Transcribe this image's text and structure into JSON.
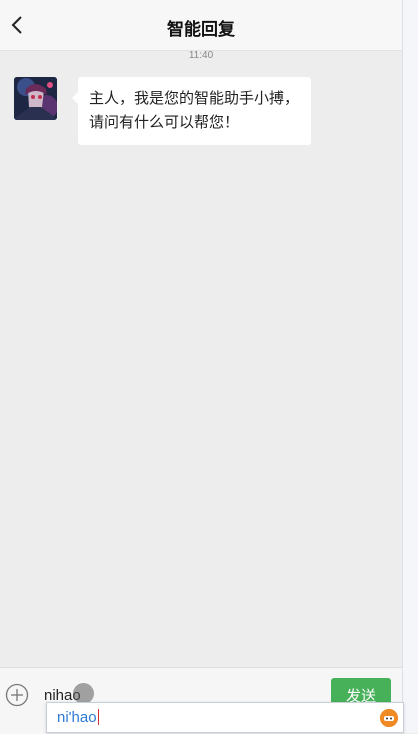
{
  "header": {
    "title": "智能回复",
    "back_icon": "chevron-left-icon"
  },
  "chat": {
    "timestamp": "11:40",
    "messages": [
      {
        "sender": "bot",
        "avatar": "anime-avatar",
        "text": "主人，我是您的智能助手小搏，请问有什么可以帮您！"
      }
    ]
  },
  "input_bar": {
    "plus_icon": "plus-circle-icon",
    "input_value": "nihao",
    "send_label": "发送"
  },
  "ime": {
    "composition": "ni'hao",
    "logo_icon": "ime-logo-icon"
  },
  "colors": {
    "background": "#ededed",
    "header": "#f7f7f7",
    "send_button": "#46b159",
    "ime_text": "#2e7bd6"
  }
}
